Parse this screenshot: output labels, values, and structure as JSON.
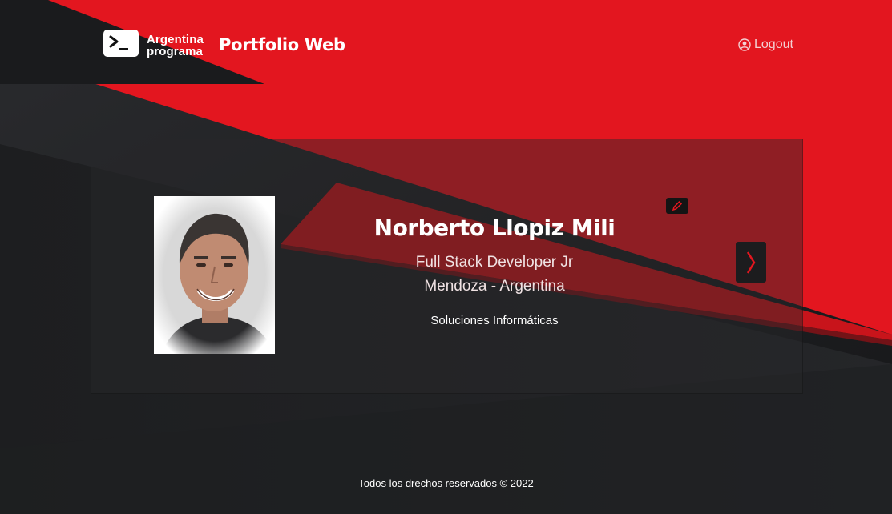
{
  "brand": {
    "line1": "Argentina",
    "line2": "programa",
    "logo_icon": "terminal-icon"
  },
  "header": {
    "title": "Portfolio Web",
    "logout_label": "Logout",
    "logout_icon": "user-circle-icon"
  },
  "profile": {
    "name": "Norberto Llopiz Mili",
    "job_title": "Full Stack Developer Jr",
    "location": "Mendoza - Argentina",
    "company": "Soluciones Informáticas",
    "edit_icon": "pencil-icon",
    "next_icon": "chevron-right-icon"
  },
  "footer": {
    "text": "Todos los drechos reservados © 2022"
  },
  "colors": {
    "accent_red": "#e3161f",
    "dark_bg": "#1b1c1e"
  }
}
